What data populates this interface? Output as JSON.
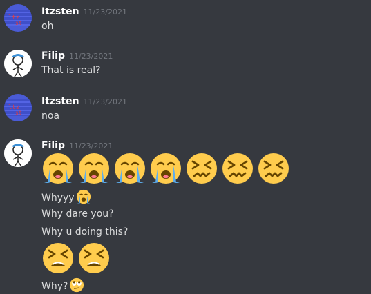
{
  "messages": [
    {
      "author": "Itzsten",
      "timestamp": "11/23/2021",
      "lines": [
        "oh"
      ]
    },
    {
      "author": "Filip",
      "timestamp": "11/23/2021",
      "lines": [
        "That is real?"
      ]
    },
    {
      "author": "Itzsten",
      "timestamp": "11/23/2021",
      "lines": [
        "noa"
      ]
    },
    {
      "author": "Filip",
      "timestamp": "11/23/2021",
      "emoji_row_1": [
        "loudly-crying-face",
        "loudly-crying-face",
        "loudly-crying-face",
        "loudly-crying-face",
        "confounded-face",
        "confounded-face",
        "confounded-face"
      ],
      "line_whyyy": "Whyyy",
      "line_dare": "Why dare you?",
      "line_doing": "Why u doing this?",
      "emoji_row_2": [
        "tired-face",
        "tired-face"
      ],
      "line_why": "Why?",
      "inline_emoji_whyyy": "loudly-crying-face",
      "inline_emoji_why": "face-with-rolling-eyes"
    }
  ],
  "colors": {
    "background": "#36393f",
    "author": "#ffffff",
    "timestamp": "#72767d",
    "text": "#dcddde"
  }
}
